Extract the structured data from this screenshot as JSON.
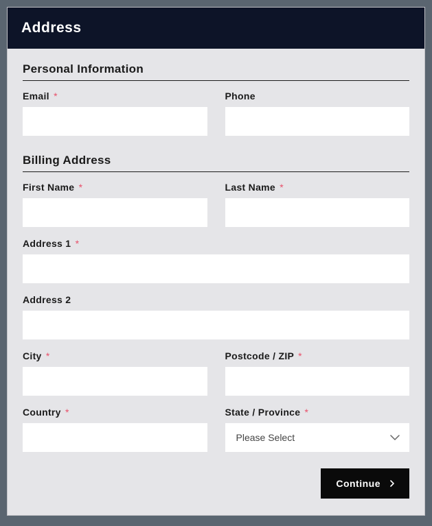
{
  "header": {
    "title": "Address"
  },
  "sections": {
    "personal": {
      "title": "Personal Information",
      "fields": {
        "email": {
          "label": "Email",
          "required": true,
          "value": ""
        },
        "phone": {
          "label": "Phone",
          "required": false,
          "value": ""
        }
      }
    },
    "billing": {
      "title": "Billing Address",
      "fields": {
        "first_name": {
          "label": "First Name",
          "required": true,
          "value": ""
        },
        "last_name": {
          "label": "Last Name",
          "required": true,
          "value": ""
        },
        "address1": {
          "label": "Address 1",
          "required": true,
          "value": ""
        },
        "address2": {
          "label": "Address 2",
          "required": false,
          "value": ""
        },
        "city": {
          "label": "City",
          "required": true,
          "value": ""
        },
        "postcode": {
          "label": "Postcode / ZIP",
          "required": true,
          "value": ""
        },
        "country": {
          "label": "Country",
          "required": true,
          "value": ""
        },
        "state": {
          "label": "State / Province",
          "required": true,
          "selected": "Please Select",
          "options": [
            "Please Select"
          ]
        }
      }
    }
  },
  "required_marker": "*",
  "buttons": {
    "continue": "Continue"
  }
}
